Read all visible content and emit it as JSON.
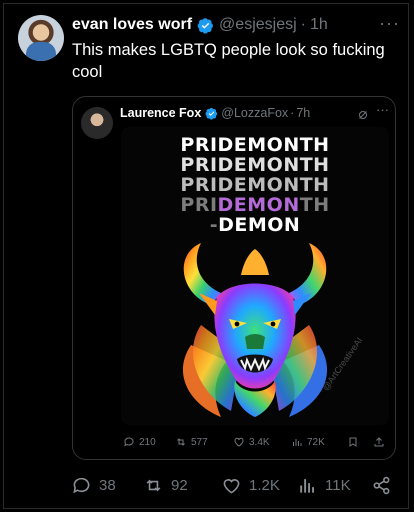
{
  "tweet": {
    "author_name": "evan loves worf",
    "handle": "@esjesjesj",
    "separator": "·",
    "time": "1h",
    "more": "···",
    "text": "This makes LGBTQ people look so fucking cool"
  },
  "quoted": {
    "author_name": "Laurence Fox",
    "handle": "@LozzaFox",
    "separator": "·",
    "time": "7h",
    "more": "···",
    "image": {
      "lines": [
        "PRIDEMONTH",
        "PRIDEMONTH",
        "PRIDEMONTH"
      ],
      "line4": {
        "a": "PRI",
        "b": "DEMON",
        "c": "TH"
      },
      "line5": {
        "a": "-",
        "b": "DEMON"
      },
      "signature": "@ArtCreativeAI"
    },
    "stats": {
      "replies": "210",
      "reposts": "577",
      "likes": "3.4K",
      "views": "72K"
    }
  },
  "stats": {
    "replies": "38",
    "reposts": "92",
    "likes": "1.2K",
    "views": "11K"
  },
  "colors": {
    "verified": "#1d9bf0",
    "muted": "#71767b"
  }
}
